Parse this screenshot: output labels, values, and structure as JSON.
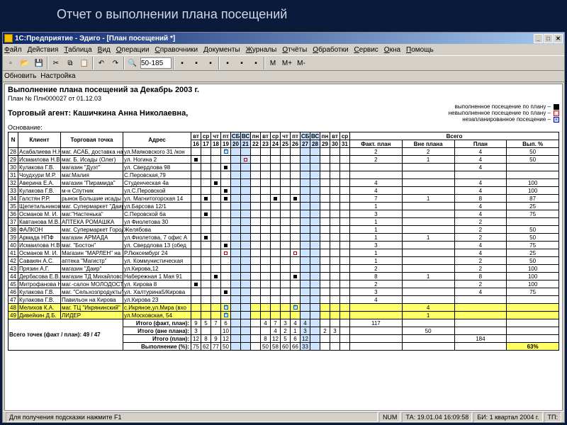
{
  "banner": "Отчет о выполнении плана посещений",
  "window": {
    "title": "1С:Предприятие - Эдиго - [План посещений *]",
    "minimize": "_",
    "maximize": "□",
    "close": "✕"
  },
  "menu": [
    "Файл",
    "Действия",
    "Таблица",
    "Вид",
    "Операции",
    "Справочники",
    "Документы",
    "Журналы",
    "Отчёты",
    "Обработки",
    "Сервис",
    "Окна",
    "Помощь"
  ],
  "toolbar": {
    "search_value": "50-185",
    "mem": [
      "М",
      "М+",
      "М-"
    ]
  },
  "toolbar2": {
    "refresh": "Обновить",
    "setup": "Настройка"
  },
  "doc": {
    "title": "Выполнение плана посещений за Декабрь 2003 г.",
    "plan_no": "План № Плн000027 от 01.12.03",
    "agent_label": "Торговый агент: Кашичкина Анна Николаевна,",
    "osn": "Основание:"
  },
  "legend": {
    "done": "выполненное посещение по плану –",
    "undone": "невыполненное посещение по плану –",
    "unplanned": "незапланированное посещение –"
  },
  "head": {
    "n": "N",
    "client": "Клиент",
    "point": "Торговая точка",
    "addr": "Адрес",
    "dow": [
      "вт",
      "ср",
      "чт",
      "пт",
      "СБ",
      "ВС",
      "пн",
      "вт",
      "ср",
      "чт",
      "пт",
      "СБ",
      "ВС",
      "пн",
      "вт",
      "ср"
    ],
    "days": [
      "16",
      "17",
      "18",
      "19",
      "20",
      "21",
      "22",
      "23",
      "24",
      "25",
      "26",
      "27",
      "28",
      "29",
      "30",
      "31"
    ],
    "totals": "Всего",
    "fact": "Факт. план",
    "out": "Вне плана",
    "plan": "План",
    "pct": "Вып. %"
  },
  "rows": [
    {
      "n": "28",
      "c": "Асабалиева Н.Н.",
      "p": "маг. АСАБ, доставка на",
      "a": "ул.Маяковского 31 /кон",
      "m": {
        "3": "bl"
      },
      "t": [
        "2",
        "2",
        "4",
        "50"
      ]
    },
    {
      "n": "29",
      "c": "Исмаилова Н.В.",
      "p": "маг. Б. Исады (Олег)",
      "a": "ул. Ногина 2",
      "m": {
        "0": "sq",
        "5": "op"
      },
      "t": [
        "2",
        "1",
        "4",
        "50"
      ]
    },
    {
      "n": "30",
      "c": "Кулакова Г.В.",
      "p": "магазин \"Дуэт\"",
      "a": "ул. Свердлова 98",
      "m": {
        "3": "sq"
      },
      "t": [
        "",
        "",
        "4",
        ""
      ]
    },
    {
      "n": "31",
      "c": "Чоудхури М.Р.",
      "p": "маг.Малия",
      "a": "С.Перовская,79",
      "m": {},
      "t": [
        "",
        "",
        "",
        ""
      ]
    },
    {
      "n": "32",
      "c": "Аверина Е.А.",
      "p": "магазин \"Пирамида\"",
      "a": "Студенческая 4а",
      "m": {
        "2": "sq"
      },
      "t": [
        "4",
        "",
        "4",
        "100"
      ]
    },
    {
      "n": "33",
      "c": "Кулакова Г.В.",
      "p": "м-н Спутник",
      "a": "ул.С.Перовской",
      "m": {
        "3": "sq"
      },
      "t": [
        "4",
        "",
        "4",
        "100"
      ]
    },
    {
      "n": "34",
      "c": "Галстян Р.Р.",
      "p": "рынок Большие исады (",
      "a": "ул. Магнитогорская 14",
      "m": {
        "1": "sq",
        "3": "sq",
        "8": "sq",
        "10": "sq"
      },
      "t": [
        "7",
        "1",
        "8",
        "87"
      ]
    },
    {
      "n": "35",
      "c": "Щепетильников М.",
      "p": "маг. Супермаркет \"Даир\"",
      "a": "ул.Барсова 12/1",
      "m": {},
      "t": [
        "1",
        "",
        "4",
        "25"
      ]
    },
    {
      "n": "36",
      "c": "Османов М. И.",
      "p": "маг.\"Настенька\"",
      "a": "С.Перовской 6а",
      "m": {
        "1": "sq"
      },
      "t": [
        "3",
        "",
        "4",
        "75"
      ]
    },
    {
      "n": "37",
      "c": "Кавтанова М.В.",
      "p": "АПТЕКА  РОМАШКА",
      "a": "ул Фиолетова 30",
      "m": {},
      "t": [
        "1",
        "",
        "2",
        ""
      ]
    },
    {
      "n": "38",
      "c": "ФАЛКОН",
      "p": "маг. Супермаркет Город",
      "a": "Желябова",
      "m": {},
      "t": [
        "1",
        "",
        "2",
        "50"
      ]
    },
    {
      "n": "39",
      "c": "Армада НПФ",
      "p": "магазин АРМАДА",
      "a": "ул.Фиолетова, 7 офис А",
      "m": {
        "1": "sq"
      },
      "t": [
        "1",
        "1",
        "2",
        "50"
      ]
    },
    {
      "n": "40",
      "c": "Исмаилова Н.В.",
      "p": "маг. \"Бостон\"",
      "a": "ул. Свердлова 13 (обед",
      "m": {
        "3": "sq"
      },
      "t": [
        "3",
        "",
        "4",
        "75"
      ]
    },
    {
      "n": "41",
      "c": "Османов М. И.",
      "p": "Магазин \"МАРЛЕН\" на Р.",
      "a": "Р.Люксембург 24",
      "m": {
        "3": "op",
        "10": "op"
      },
      "t": [
        "1",
        "",
        "4",
        "25"
      ]
    },
    {
      "n": "42",
      "c": "Савакян А.С.",
      "p": "аптека \"Магистр\"",
      "a": "ул. Коммунистическая",
      "m": {},
      "t": [
        "1",
        "",
        "2",
        "50"
      ]
    },
    {
      "n": "43",
      "c": "Прязин А.Г.",
      "p": "магазин \"Даир\"",
      "a": "ул.Кирова,12",
      "m": {},
      "t": [
        "2",
        "",
        "2",
        "100"
      ]
    },
    {
      "n": "44",
      "c": "Дербасова Е.В.",
      "p": "магазин ТД Михайловск",
      "a": "Набережная 1 Мая 91",
      "m": {
        "2": "sq",
        "10": "sq"
      },
      "t": [
        "8",
        "1",
        "8",
        "100"
      ]
    },
    {
      "n": "45",
      "c": "Митрофанова Н.Р.",
      "p": "маг.-салон МОЛОДОСТЬ",
      "a": "ул. Кирова 8",
      "m": {
        "0": "sq"
      },
      "t": [
        "2",
        "",
        "2",
        "100"
      ]
    },
    {
      "n": "46",
      "c": "Кулакова Г.В.",
      "p": "маг. \"Сельхозпродукты\"",
      "a": "ул. Халтурина5/Кирова",
      "m": {
        "3": "sq"
      },
      "t": [
        "3",
        "",
        "4",
        "75"
      ]
    },
    {
      "n": "47",
      "c": "Кулакова Г.В.",
      "p": "Павильон на Кирова",
      "a": "ул.Кирова 23",
      "m": {},
      "t": [
        "4",
        "",
        "",
        ""
      ]
    },
    {
      "n": "48",
      "c": "Мелихов К.А.",
      "p": "маг. ТЦ \"Икрянинский\"",
      "a": "с.Икряное,ул.Мира (вхо",
      "m": {
        "3": "bl",
        "10": "bl"
      },
      "hl": true,
      "t": [
        "",
        "4",
        "",
        ""
      ]
    },
    {
      "n": "49",
      "c": "Дивейкин Д.Б.",
      "p": "ЛИДЕР",
      "a": "ул.Московская, 54",
      "m": {
        "3": "bl"
      },
      "hl": true,
      "t": [
        "",
        "1",
        "",
        ""
      ]
    }
  ],
  "totals": {
    "points_label": "Всего точек (факт / план): 49 / 47",
    "rows": [
      {
        "label": "Итого (факт, план):",
        "d": [
          "9",
          "5",
          "7",
          "6",
          "",
          "",
          "",
          "4",
          "7",
          "3",
          "4",
          "4",
          "",
          "",
          "",
          ""
        ],
        "t": [
          "117",
          "",
          "",
          ""
        ]
      },
      {
        "label": "Итого (вне плана):",
        "d": [
          "3",
          "",
          "",
          "10",
          "",
          "",
          "",
          "",
          "4",
          "2",
          "1",
          "3",
          "",
          "2",
          "3",
          ""
        ],
        "t": [
          "",
          "50",
          "",
          ""
        ]
      },
      {
        "label": "Итого (план):",
        "d": [
          "12",
          "8",
          "9",
          "12",
          "",
          "",
          "",
          "8",
          "12",
          "5",
          "6",
          "12",
          "",
          "",
          "",
          ""
        ],
        "t": [
          "",
          "",
          "184",
          ""
        ]
      },
      {
        "label": "Выполнение (%):",
        "d": [
          "75",
          "62",
          "77",
          "50",
          "",
          "",
          "",
          "50",
          "58",
          "60",
          "66",
          "33",
          "",
          "",
          "",
          ""
        ],
        "t": [
          "",
          "",
          "",
          "63%"
        ]
      }
    ]
  },
  "status": {
    "hint": "Для получения подсказки нажмите F1",
    "num": "NUM",
    "ta": "ТА: 19.01.04 16:09:58",
    "bi": "БИ: 1 квартал 2004 г.",
    "tp": "ТП:"
  }
}
